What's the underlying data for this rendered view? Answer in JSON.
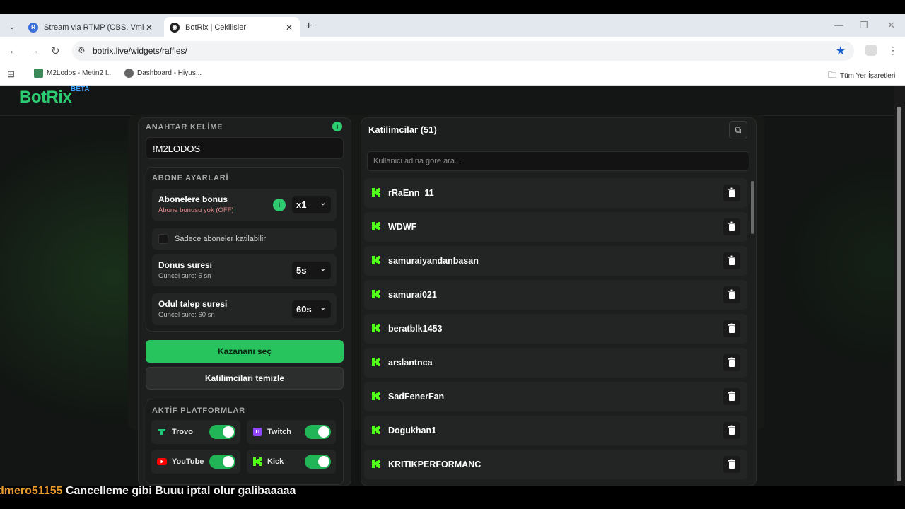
{
  "browser": {
    "tabs": [
      {
        "title": "Stream via RTMP (OBS, Vmix, Z...",
        "icon": "restream-icon",
        "active": false
      },
      {
        "title": "BotRix | Cekilisler",
        "icon": "botrix-icon",
        "active": true
      }
    ],
    "url": "botrix.live/widgets/raffles/",
    "bookmarks": [
      {
        "label": "M2Lodos - Metin2 İ...",
        "icon": "m2lodos-icon"
      },
      {
        "label": "Dashboard - Hiyus...",
        "icon": "globe-icon"
      }
    ],
    "bookmarks_folder": "Tüm Yer İşaretleri"
  },
  "brand": {
    "name": "BotRix",
    "badge": "BETA",
    "accent": "#2ecc71"
  },
  "left": {
    "keyword_label": "ANAHTAR KELİME",
    "keyword_value": "!M2LODOS",
    "sub_settings_label": "ABONE AYARLARİ",
    "sub_bonus": {
      "title": "Abonelere bonus",
      "subtitle": "Abone bonusu yok (OFF)",
      "value": "x1"
    },
    "subs_only": {
      "label": "Sadece aboneler katilabilir",
      "checked": false
    },
    "spin_time": {
      "title": "Donus suresi",
      "subtitle": "Guncel sure: 5 sn",
      "value": "5s"
    },
    "claim_time": {
      "title": "Odul talep suresi",
      "subtitle": "Guncel sure: 60 sn",
      "value": "60s"
    },
    "pick_winner": "Kazananı seç",
    "clear_participants": "Katilimcilari temizle",
    "platforms_label": "AKTİF PLATFORMLAR",
    "platforms": [
      {
        "name": "Trovo",
        "enabled": true,
        "color": "#1ec77a"
      },
      {
        "name": "Twitch",
        "enabled": true,
        "color": "#9146ff"
      },
      {
        "name": "YouTube",
        "enabled": true,
        "color": "#ff0000"
      },
      {
        "name": "Kick",
        "enabled": true,
        "color": "#53fc18"
      }
    ]
  },
  "right": {
    "title": "Katilimcilar (51)",
    "search_placeholder": "Kullanici adina gore ara...",
    "participants": [
      "rRaEnn_11",
      "WDWF",
      "samuraiyandanbasan",
      "samurai021",
      "beratblk1453",
      "arslantnca",
      "SadFenerFan",
      "Dogukhan1",
      "KRITIKPERFORMANC"
    ]
  },
  "ticker": {
    "prefix": "dmero51155",
    "text": "Cancelleme gibi Buuu iptal olur galibaaaaa"
  }
}
